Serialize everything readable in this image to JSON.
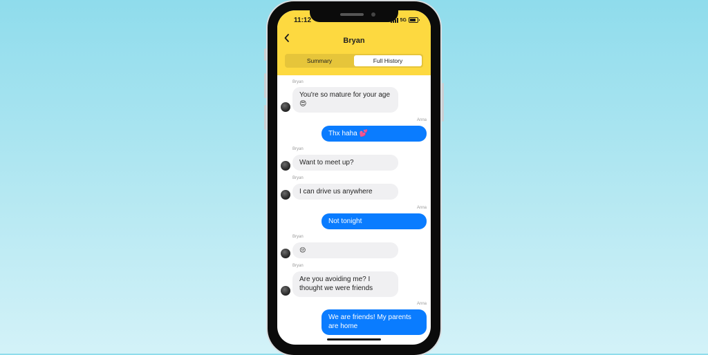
{
  "status_bar": {
    "time": "11:12",
    "network": "5G"
  },
  "header": {
    "back_icon": "chevron-left-icon",
    "back_glyph": "‹",
    "title": "Bryan"
  },
  "segments": {
    "summary": "Summary",
    "full_history": "Full History",
    "selected": "Full History"
  },
  "colors": {
    "header_yellow": "#fdd940",
    "outgoing_blue": "#0a7cff",
    "incoming_gray": "#f0f0f2"
  },
  "messages": [
    {
      "sender": "Bryan",
      "direction": "in",
      "text": "You're so mature for your age 😍"
    },
    {
      "sender": "Anna",
      "direction": "out",
      "text": "Thx haha 💕"
    },
    {
      "sender": "Bryan",
      "direction": "in",
      "text": "Want to meet up?"
    },
    {
      "sender": "Bryan",
      "direction": "in",
      "text": "I can drive us anywhere"
    },
    {
      "sender": "Anna",
      "direction": "out",
      "text": "Not tonight"
    },
    {
      "sender": "Bryan",
      "direction": "in",
      "text": "😒"
    },
    {
      "sender": "Bryan",
      "direction": "in",
      "text": "Are you avoiding me? I thought we were friends"
    },
    {
      "sender": "Anna",
      "direction": "out",
      "text": "We are friends! My parents are home"
    }
  ]
}
